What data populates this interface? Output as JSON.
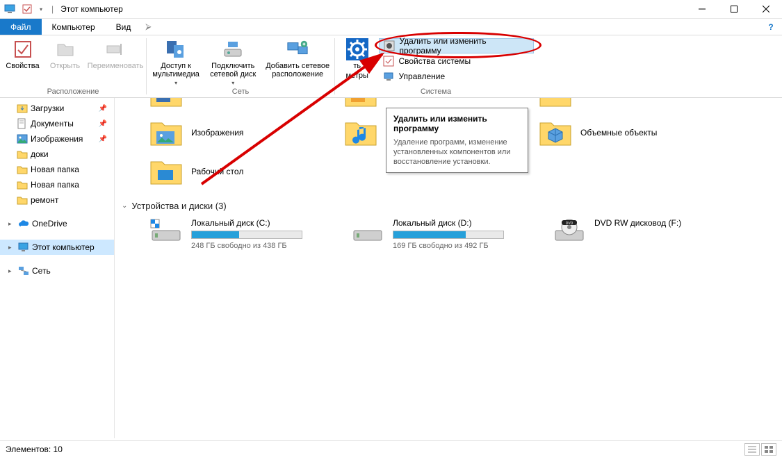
{
  "window": {
    "title": "Этот компьютер",
    "separator": "|"
  },
  "tabs": {
    "file": "Файл",
    "computer": "Компьютер",
    "view": "Вид"
  },
  "ribbon": {
    "location_group": "Расположение",
    "network_group": "Сеть",
    "system_group": "Система",
    "properties": "Свойства",
    "open": "Открыть",
    "rename": "Переименовать",
    "media_access": "Доступ к мультимедиа",
    "map_drive": "Подключить сетевой диск",
    "add_net_location": "Добавить сетевое расположение",
    "open_settings_top": "ть",
    "open_settings_bottom": "метры",
    "uninstall_change": "Удалить или изменить программу",
    "system_props": "Свойства системы",
    "manage": "Управление"
  },
  "tooltip": {
    "title": "Удалить или изменить программу",
    "body": "Удаление программ, изменение установленных компонентов или восстановление установки."
  },
  "nav": {
    "downloads": "Загрузки",
    "documents": "Документы",
    "pictures": "Изображения",
    "doki": "доки",
    "new_folder": "Новая папка",
    "new_folder2": "Новая папка",
    "repair": "ремонт",
    "onedrive": "OneDrive",
    "this_pc": "Этот компьютер",
    "network": "Сеть"
  },
  "folders": {
    "images": "Изображения",
    "music": "Музыка",
    "desktop": "Рабочий стол",
    "objects3d": "Объемные объекты"
  },
  "section": {
    "devices_drives": "Устройства и диски (3)"
  },
  "drives": {
    "c": {
      "name": "Локальный диск (C:)",
      "free": "248 ГБ свободно из 438 ГБ",
      "pct": 43
    },
    "d": {
      "name": "Локальный диск (D:)",
      "free": "169 ГБ свободно из 492 ГБ",
      "pct": 66
    },
    "dvd": {
      "name": "DVD RW дисковод (F:)"
    }
  },
  "statusbar": {
    "elements": "Элементов: 10"
  }
}
